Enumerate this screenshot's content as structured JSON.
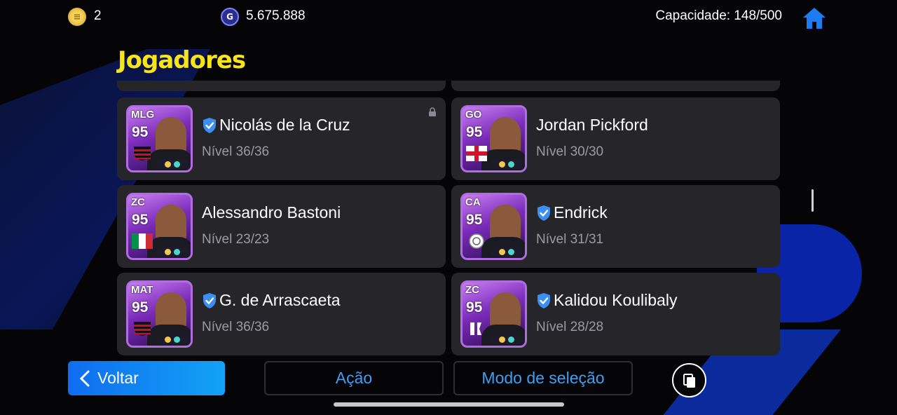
{
  "topbar": {
    "coins_value": "2",
    "gp_value": "5.675.888",
    "capacity_text": "Capacidade: 148/500",
    "coin_icon": "efootball-coin-icon",
    "gp_icon": "gp-icon",
    "home_icon": "home-icon"
  },
  "page": {
    "title": "Jogadores"
  },
  "players": [
    {
      "position": "MLG",
      "rating": "95",
      "name": "Nicolás de la Cruz",
      "level": "Nível 36/36",
      "verified": true,
      "locked": true,
      "flag": "flamengo",
      "col": 0,
      "row": 0
    },
    {
      "position": "GO",
      "rating": "95",
      "name": "Jordan Pickford",
      "level": "Nível 30/30",
      "verified": false,
      "locked": false,
      "flag": "england",
      "col": 1,
      "row": 0
    },
    {
      "position": "ZC",
      "rating": "95",
      "name": "Alessandro Bastoni",
      "level": "Nível 23/23",
      "verified": false,
      "locked": false,
      "flag": "italy",
      "col": 0,
      "row": 1
    },
    {
      "position": "CA",
      "rating": "95",
      "name": "Endrick",
      "level": "Nível 31/31",
      "verified": true,
      "locked": false,
      "flag": "real-madrid",
      "col": 1,
      "row": 1
    },
    {
      "position": "MAT",
      "rating": "95",
      "name": "G. de Arrascaeta",
      "level": "Nível 36/36",
      "verified": true,
      "locked": false,
      "flag": "flamengo",
      "col": 0,
      "row": 2
    },
    {
      "position": "ZC",
      "rating": "95",
      "name": "Kalidou Koulibaly",
      "level": "Nível 28/28",
      "verified": true,
      "locked": false,
      "flag": "al-hilal",
      "col": 1,
      "row": 2
    }
  ],
  "bottom": {
    "back_label": "Voltar",
    "action_label": "Ação",
    "mode_label": "Modo de seleção",
    "copy_icon": "copy-icon"
  },
  "colors": {
    "title": "#f7e41a",
    "card": "#25252a",
    "accent_blue": "#3da0f5",
    "verified": "#3b8ff0"
  }
}
